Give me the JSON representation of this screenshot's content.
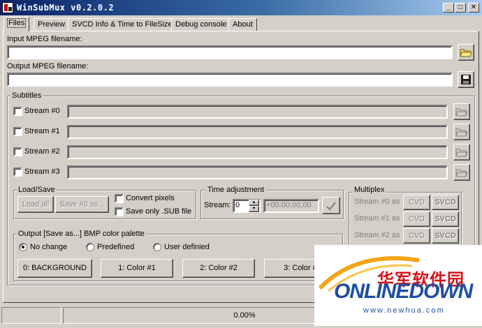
{
  "window": {
    "title": "WinSubMux v0.2.0.2"
  },
  "caption_buttons": {
    "minimize": "_",
    "maximize": "□",
    "close": "✕"
  },
  "tabs": [
    "Files",
    "Preview",
    "SVCD Info & Time to FileSize",
    "Debug console",
    "About"
  ],
  "files": {
    "input_label": "Input MPEG filename:",
    "input_value": "",
    "output_label": "Output MPEG filename:",
    "output_value": ""
  },
  "subtitles": {
    "legend": "Subtitles",
    "streams": [
      "Stream #0",
      "Stream #1",
      "Stream #2",
      "Stream #3"
    ]
  },
  "load_save": {
    "legend": "Load/Save",
    "load_all": "Load all",
    "save_as": "Save #0 as...",
    "convert_pixels": "Convert pixels",
    "save_only_sub": "Save only .SUB file"
  },
  "time_adjustment": {
    "legend": "Time adjustment",
    "stream_label": "Stream:",
    "stream_value": "0",
    "offset_value": "+00:00:00,00"
  },
  "multiplex": {
    "legend": "Multiplex",
    "rows": [
      {
        "label": "Stream #0 as",
        "cvd": "CVD",
        "svcd": "SVCD"
      },
      {
        "label": "Stream #1 as",
        "cvd": "CVD",
        "svcd": "SVCD"
      },
      {
        "label": "Stream #2 as",
        "cvd": "CVD",
        "svcd": "SVCD"
      }
    ]
  },
  "palette": {
    "legend": "Output [Save as...] BMP color palette",
    "options": [
      "No change",
      "Predefined",
      "User definied"
    ],
    "selected": "No change",
    "buttons": [
      "0: BACKGROUND",
      "1: Color #1",
      "2: Color #2",
      "3: Color #"
    ]
  },
  "status": {
    "progress_text": "0.00%"
  },
  "watermark": {
    "chinese": "华军软件园",
    "brand": "ONLINEDOWN",
    "url": "www.newhua.com"
  },
  "colors": {
    "title_start": "#0a246a",
    "title_end": "#a6caf0",
    "face": "#d4d0c8",
    "brand_blue": "#1e4fa0",
    "brand_red": "#d3121a"
  }
}
